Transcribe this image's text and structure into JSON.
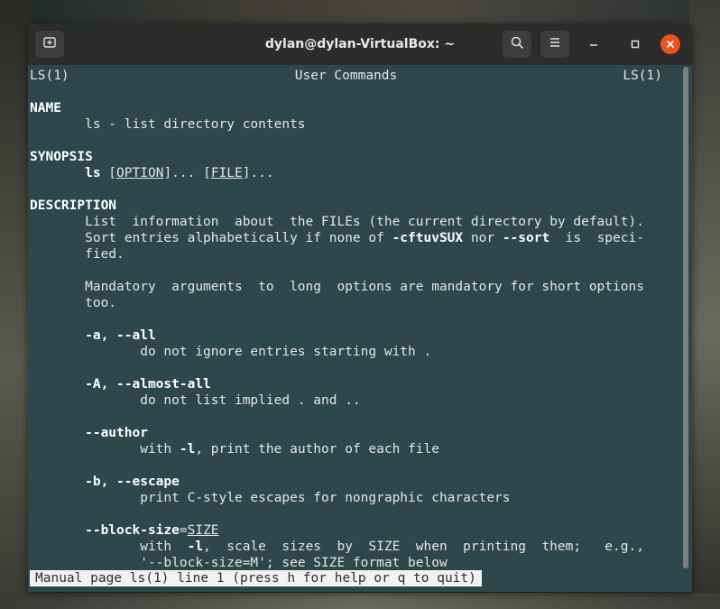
{
  "window": {
    "title": "dylan@dylan-VirtualBox: ~"
  },
  "icons": {
    "new_tab": "new-tab-icon",
    "search": "search-icon",
    "menu": "hamburger-menu-icon",
    "minimize": "minimize-icon",
    "maximize": "maximize-icon",
    "close": "close-icon"
  },
  "colors": {
    "terminal_bg": "#2d474c",
    "titlebar": "#2c2c2c",
    "close": "#e95420"
  },
  "man": {
    "header_left": "LS(1)",
    "header_center": "User Commands",
    "header_right": "LS(1)",
    "name_heading": "NAME",
    "name_text": "ls - list directory contents",
    "synopsis_heading": "SYNOPSIS",
    "synopsis_cmd": "ls",
    "synopsis_option": "OPTION",
    "synopsis_file": "FILE",
    "description_heading": "DESCRIPTION",
    "desc_line1": "List  information  about  the FILEs (the current directory by default).",
    "desc_line2a": "Sort entries alphabetically if none of ",
    "desc_line2b": "-cftuvSUX",
    "desc_line2c": " nor ",
    "desc_line2d": "--sort",
    "desc_line2e": "  is  speci-",
    "desc_line3": "fied.",
    "mandatory_line1": "Mandatory  arguments  to  long  options are mandatory for short options",
    "mandatory_line2": "too.",
    "opt_a": "-a, --all",
    "opt_a_desc": "do not ignore entries starting with .",
    "opt_A": "-A, --almost-all",
    "opt_A_desc": "do not list implied . and ..",
    "opt_author": "--author",
    "opt_author_desc_a": "with ",
    "opt_author_desc_b": "-l",
    "opt_author_desc_c": ", print the author of each file",
    "opt_b": "-b, --escape",
    "opt_b_desc": "print C-style escapes for nongraphic characters",
    "opt_bs": "--block-size",
    "opt_bs_eq": "=",
    "opt_bs_arg": "SIZE",
    "opt_bs_desc1a": "with  ",
    "opt_bs_desc1b": "-l",
    "opt_bs_desc1c": ",  scale  sizes  by  SIZE  when  printing  them;   e.g.,",
    "opt_bs_desc2": "'--block-size=M'; see SIZE format below"
  },
  "status": "Manual page ls(1) line 1 (press h for help or q to quit)"
}
